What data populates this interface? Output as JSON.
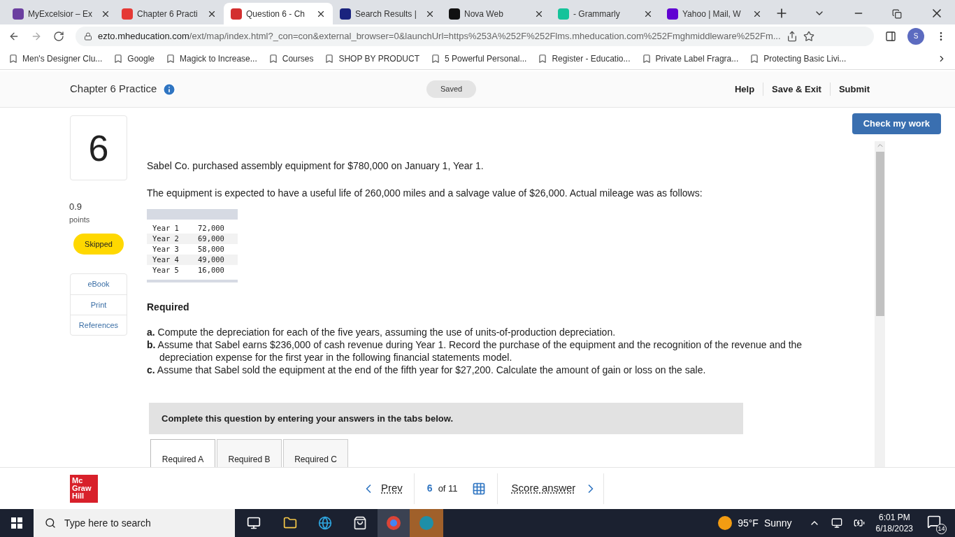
{
  "browser": {
    "tabs": [
      {
        "title": "MyExcelsior – Ex",
        "selected": false
      },
      {
        "title": "Chapter 6 Practi",
        "selected": false
      },
      {
        "title": "Question 6 - Ch",
        "selected": true
      },
      {
        "title": "Search Results |",
        "selected": false
      },
      {
        "title": "Nova Web",
        "selected": false
      },
      {
        "title": "- Grammarly",
        "selected": false
      },
      {
        "title": "Yahoo | Mail, W",
        "selected": false
      }
    ],
    "url_host": "ezto.mheducation.com",
    "url_path": "/ext/map/index.html?_con=con&external_browser=0&launchUrl=https%253A%252F%252Flms.mheducation.com%252Fmghmiddleware%252Fm...",
    "profile": "S",
    "bookmarks": [
      "Men's Designer Clu...",
      "Google",
      "Magick to Increase...",
      "Courses",
      "SHOP BY PRODUCT",
      "5 Powerful Personal...",
      "Register - Educatio...",
      "Private Label Fragra...",
      "Protecting Basic Livi..."
    ]
  },
  "header": {
    "title": "Chapter 6 Practice",
    "status": "Saved",
    "links": [
      "Help",
      "Save & Exit",
      "Submit"
    ]
  },
  "question": {
    "number": "6",
    "points": "0.9",
    "points_label": "points",
    "status": "Skipped",
    "side_links": [
      "eBook",
      "Print",
      "References"
    ],
    "check_button": "Check my work",
    "intro": [
      "Sabel Co. purchased assembly equipment for $780,000 on January 1, Year 1.",
      "The equipment is expected to have a useful life of 260,000 miles and a salvage value of $26,000. Actual mileage was as follows:"
    ],
    "mileage": [
      {
        "year": "Year 1",
        "miles": "72,000"
      },
      {
        "year": "Year 2",
        "miles": "69,000"
      },
      {
        "year": "Year 3",
        "miles": "58,000"
      },
      {
        "year": "Year 4",
        "miles": "49,000"
      },
      {
        "year": "Year 5",
        "miles": "16,000"
      }
    ],
    "required_heading": "Required",
    "requirements": [
      {
        "label": "a.",
        "text": "Compute the depreciation for each of the five years, assuming the use of units-of-production depreciation."
      },
      {
        "label": "b.",
        "text": "Assume that Sabel earns $236,000 of cash revenue during Year 1. Record the purchase of the equipment and the recognition of the revenue and the depreciation expense for the first year in the following financial statements model."
      },
      {
        "label": "c.",
        "text": "Assume that Sabel sold the equipment at the end of the fifth year for $27,200. Calculate the amount of gain or loss on the sale."
      }
    ],
    "instruction": "Complete this question by entering your answers in the tabs below.",
    "answer_tabs": [
      {
        "label": "Required A",
        "selected": true
      },
      {
        "label": "Required B",
        "selected": false
      },
      {
        "label": "Required C",
        "selected": false
      }
    ]
  },
  "footer": {
    "logo": [
      "Mc",
      "Graw",
      "Hill"
    ],
    "prev": "Prev",
    "current": "6",
    "total": "of 11",
    "score": "Score answer"
  },
  "taskbar": {
    "search_placeholder": "Type here to search",
    "temperature": "95°F",
    "weather": "Sunny",
    "time": "6:01 PM",
    "date": "6/18/2023",
    "notifications": "14"
  }
}
